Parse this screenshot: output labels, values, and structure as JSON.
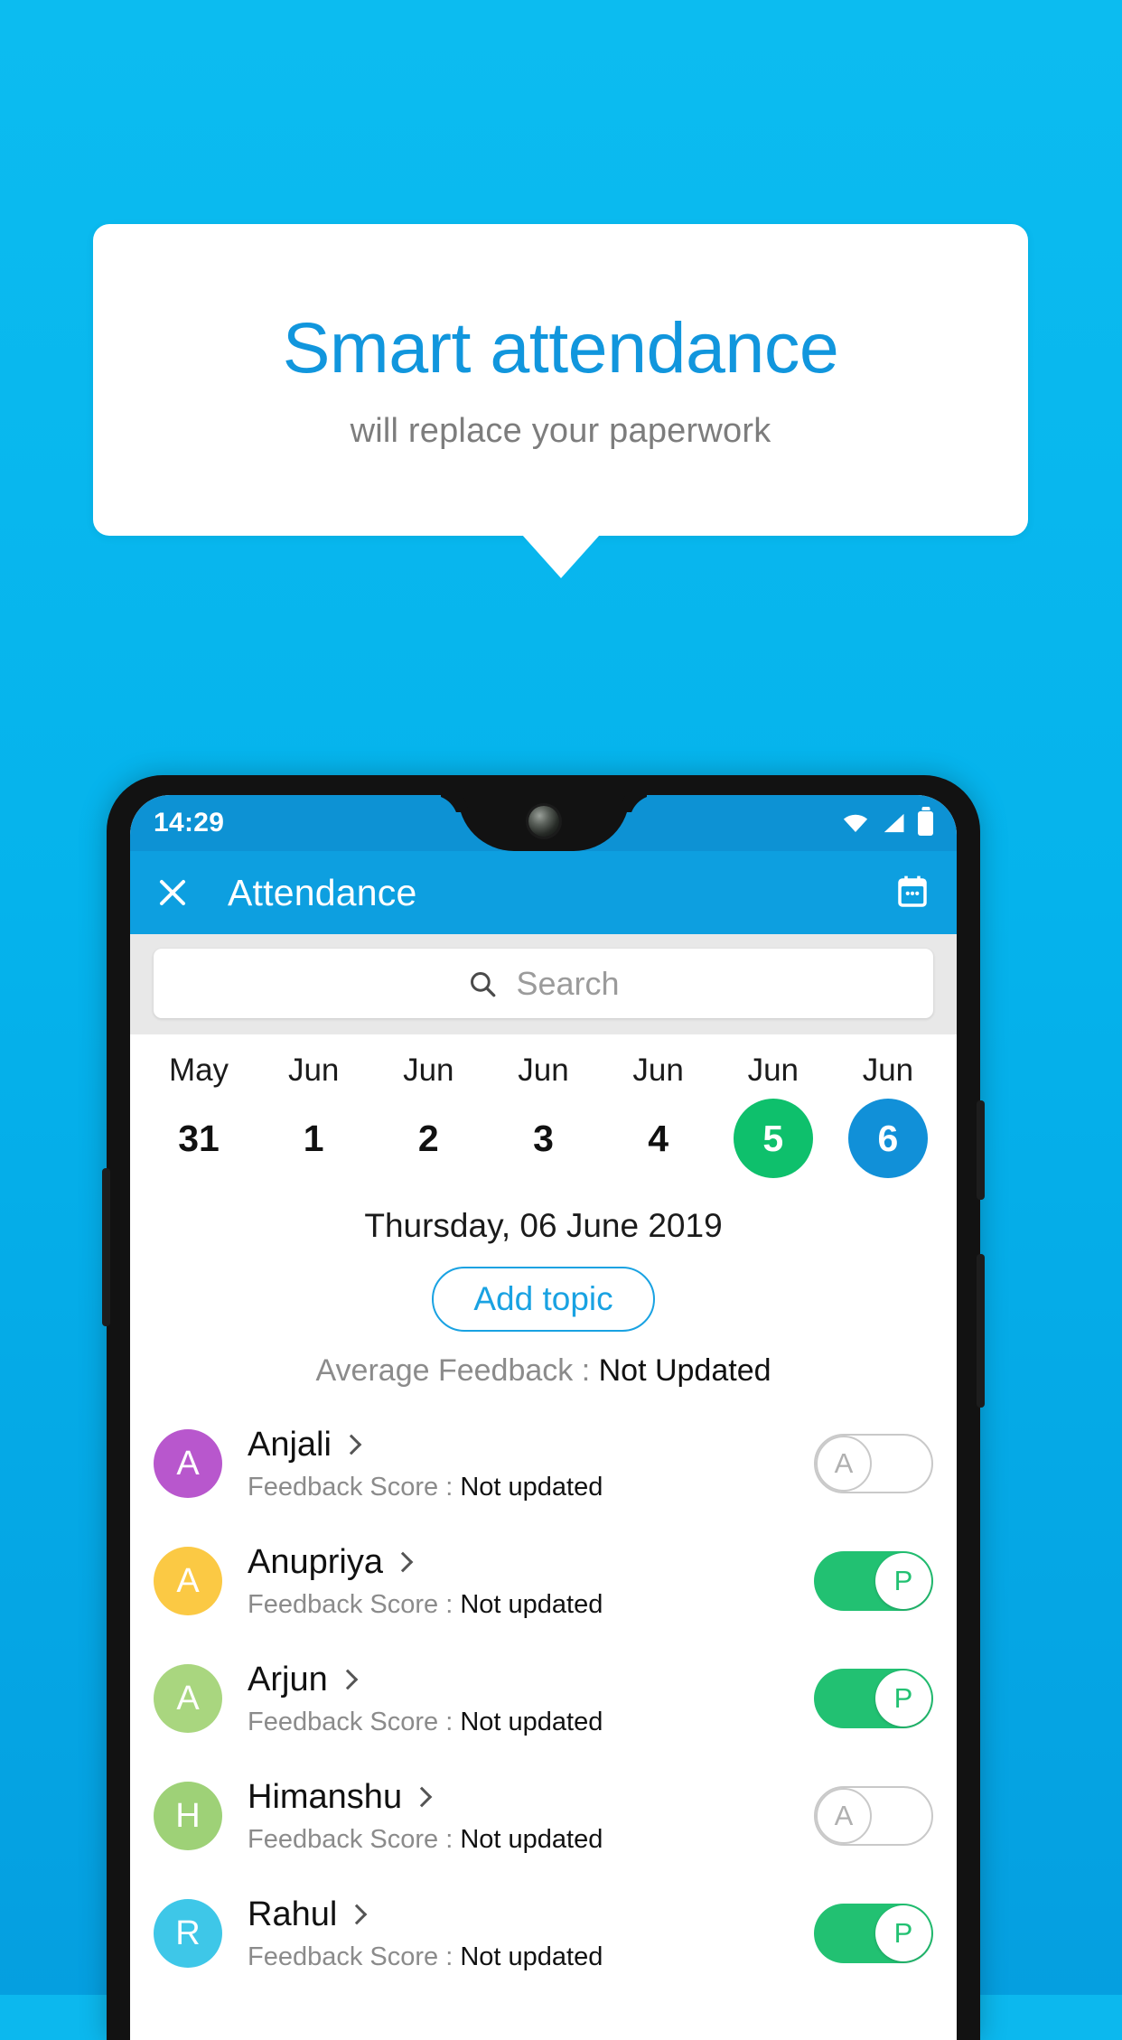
{
  "promo": {
    "headline": "Smart attendance",
    "subhead": "will replace your paperwork",
    "headline_color": "#1196dd",
    "background_color": "#0cb8ee"
  },
  "phone": {
    "statusbar": {
      "time": "14:29",
      "icons": [
        "wifi-icon",
        "signal-icon",
        "battery-icon"
      ]
    },
    "appbar": {
      "close_icon": "close-icon",
      "title": "Attendance",
      "calendar_icon": "calendar-icon",
      "background_color": "#0d9fe0"
    },
    "search": {
      "icon": "search-icon",
      "placeholder": "Search",
      "value": ""
    },
    "dates": [
      {
        "month": "May",
        "day": "31",
        "state": "normal"
      },
      {
        "month": "Jun",
        "day": "1",
        "state": "normal"
      },
      {
        "month": "Jun",
        "day": "2",
        "state": "normal"
      },
      {
        "month": "Jun",
        "day": "3",
        "state": "normal"
      },
      {
        "month": "Jun",
        "day": "4",
        "state": "normal"
      },
      {
        "month": "Jun",
        "day": "5",
        "state": "green"
      },
      {
        "month": "Jun",
        "day": "6",
        "state": "blue"
      }
    ],
    "selected_date_label": "Thursday, 06 June 2019",
    "add_topic_label": "Add topic",
    "average_feedback_label": "Average Feedback : ",
    "average_feedback_value": "Not Updated",
    "feedback_score_label": "Feedback Score : ",
    "students": [
      {
        "name": "Anjali",
        "initial": "A",
        "avatar_color": "#b857cd",
        "score": "Not updated",
        "status": "A",
        "present": false
      },
      {
        "name": "Anupriya",
        "initial": "A",
        "avatar_color": "#fbc944",
        "score": "Not updated",
        "status": "P",
        "present": true
      },
      {
        "name": "Arjun",
        "initial": "A",
        "avatar_color": "#a9d67f",
        "score": "Not updated",
        "status": "P",
        "present": true
      },
      {
        "name": "Himanshu",
        "initial": "H",
        "avatar_color": "#9ed177",
        "score": "Not updated",
        "status": "A",
        "present": false
      },
      {
        "name": "Rahul",
        "initial": "R",
        "avatar_color": "#3ec7e8",
        "score": "Not updated",
        "status": "P",
        "present": true
      }
    ]
  }
}
